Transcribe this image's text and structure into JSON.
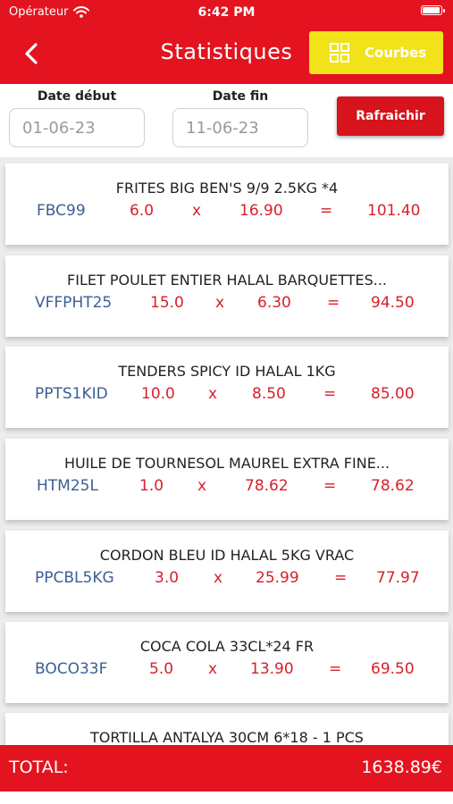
{
  "status_bar": {
    "carrier": "Opérateur",
    "time": "6:42 PM",
    "battery_level": 0.95
  },
  "header": {
    "title": "Statistiques",
    "courbes_label": "Courbes"
  },
  "filters": {
    "start_label": "Date début",
    "start_value": "01-06-23",
    "end_label": "Date fin",
    "end_value": "11-06-23",
    "refresh_label": "Rafraichir"
  },
  "items": [
    {
      "name": "FRITES BIG BEN'S 9/9 2.5KG *4",
      "code": "FBC99",
      "qty": "6.0",
      "times": "x",
      "price": "16.90",
      "equals": "=",
      "total": "101.40"
    },
    {
      "name": "FILET POULET ENTIER HALAL BARQUETTES...",
      "code": "VFFPHT25",
      "qty": "15.0",
      "times": "x",
      "price": "6.30",
      "equals": "=",
      "total": "94.50"
    },
    {
      "name": "TENDERS SPICY ID HALAL 1KG",
      "code": "PPTS1KID",
      "qty": "10.0",
      "times": "x",
      "price": "8.50",
      "equals": "=",
      "total": "85.00"
    },
    {
      "name": "HUILE DE TOURNESOL MAUREL EXTRA FINE...",
      "code": "HTM25L",
      "qty": "1.0",
      "times": "x",
      "price": "78.62",
      "equals": "=",
      "total": "78.62"
    },
    {
      "name": "CORDON BLEU ID HALAL 5KG VRAC",
      "code": "PPCBL5KG",
      "qty": "3.0",
      "times": "x",
      "price": "25.99",
      "equals": "=",
      "total": "77.97"
    },
    {
      "name": "COCA COLA 33CL*24 FR",
      "code": "BOCO33F",
      "qty": "5.0",
      "times": "x",
      "price": "13.90",
      "equals": "=",
      "total": "69.50"
    },
    {
      "name": "TORTILLA  ANTALYA 30CM 6*18 - 1 PCS"
    }
  ],
  "footer": {
    "total_label": "TOTAL:",
    "total_value": "1638.89€"
  },
  "colors": {
    "primary_red": "#e3141f",
    "accent_yellow": "#f2e21a",
    "code_blue": "#3b5f93"
  }
}
